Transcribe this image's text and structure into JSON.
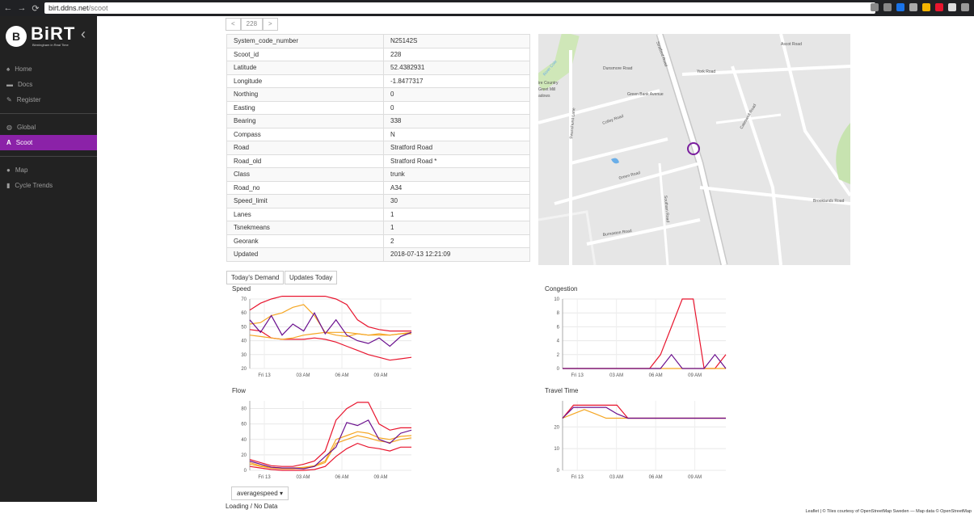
{
  "browser": {
    "url_host": "birt.ddns.net",
    "url_path": "/scoot"
  },
  "sidebar": {
    "brand": "BiRT",
    "tagline": "Birmingham in Real Time",
    "items": [
      {
        "label": "Home",
        "icon": "home-icon"
      },
      {
        "label": "Docs",
        "icon": "folder-icon"
      },
      {
        "label": "Register",
        "icon": "pencil-icon"
      },
      {
        "label": "Global",
        "icon": "globe-icon"
      },
      {
        "label": "Scoot",
        "icon": "scoot-icon"
      },
      {
        "label": "Map",
        "icon": "map-marker-icon"
      },
      {
        "label": "Cycle Trends",
        "icon": "bar-chart-icon"
      }
    ],
    "active": "Scoot"
  },
  "pager": {
    "prev": "<",
    "value": "228",
    "next": ">"
  },
  "properties": [
    [
      "System_code_number",
      "N25142S"
    ],
    [
      "Scoot_id",
      "228"
    ],
    [
      "Latitude",
      "52.4382931"
    ],
    [
      "Longitude",
      "-1.8477317"
    ],
    [
      "Northing",
      "0"
    ],
    [
      "Easting",
      "0"
    ],
    [
      "Bearing",
      "338"
    ],
    [
      "Compass",
      "N"
    ],
    [
      "Road",
      "Stratford Road"
    ],
    [
      "Road_old",
      "Stratford Road *"
    ],
    [
      "Class",
      "trunk"
    ],
    [
      "Road_no",
      "A34"
    ],
    [
      "Speed_limit",
      "30"
    ],
    [
      "Lanes",
      "1"
    ],
    [
      "Tsnekmeans",
      "1"
    ],
    [
      "Georank",
      "2"
    ],
    [
      "Updated",
      "2018-07-13 12:21:09"
    ]
  ],
  "map_labels": [
    "Stratford Road",
    "York Road",
    "Green Bank Avenue",
    "Cateswell Road",
    "Colley Road",
    "Green Road",
    "Burnaston Road",
    "Brooklands Road",
    "Swanshurst Lane",
    "Southam Road",
    "Ascot Road",
    "Dunsmore Road",
    "River Cole",
    "ire Country",
    "Greet Mill",
    "adows"
  ],
  "tabs": {
    "demand": "Today's Demand",
    "updates": "Updates Today"
  },
  "dropdown": {
    "label": "averagespeed"
  },
  "status": "Loading / No Data",
  "attribution": "Leaflet | © Tiles courtesy of OpenStreetMap Sweden — Map data © OpenStreetMap",
  "colors": {
    "active": "#8b22a8",
    "series_purple": "#6a0f8e",
    "series_red": "#e8152e",
    "series_orange": "#f5a623"
  },
  "chart_data": [
    {
      "type": "line",
      "title": "Speed",
      "x_ticks": [
        "Fri 13",
        "03 AM",
        "06 AM",
        "09 AM"
      ],
      "ylim": [
        20,
        70
      ],
      "y_ticks": [
        20,
        30,
        40,
        50,
        60,
        70
      ],
      "series": [
        {
          "color": "#e8152e",
          "values": [
            62,
            67,
            70,
            72,
            72,
            72,
            72,
            72,
            70,
            66,
            55,
            50,
            48,
            47,
            47,
            47
          ]
        },
        {
          "color": "#e8152e",
          "values": [
            48,
            47,
            42,
            41,
            41,
            41,
            42,
            41,
            39,
            36,
            33,
            30,
            28,
            26,
            27,
            28
          ]
        },
        {
          "color": "#f5a623",
          "values": [
            52,
            53,
            58,
            60,
            64,
            66,
            58,
            46,
            44,
            43,
            45,
            44,
            45,
            44,
            45,
            46
          ]
        },
        {
          "color": "#f5a623",
          "values": [
            44,
            43,
            42,
            41,
            42,
            44,
            45,
            46,
            46,
            46,
            45,
            44,
            44,
            44,
            45,
            45
          ]
        },
        {
          "color": "#6a0f8e",
          "values": [
            55,
            46,
            58,
            44,
            52,
            47,
            60,
            45,
            55,
            44,
            40,
            38,
            42,
            36,
            43,
            46
          ]
        }
      ]
    },
    {
      "type": "line",
      "title": "Congestion",
      "x_ticks": [
        "Fri 13",
        "03 AM",
        "06 AM",
        "09 AM"
      ],
      "ylim": [
        0,
        10
      ],
      "y_ticks": [
        0,
        2,
        4,
        6,
        8,
        10
      ],
      "series": [
        {
          "color": "#e8152e",
          "values": [
            0,
            0,
            0,
            0,
            0,
            0,
            0,
            0,
            0,
            2,
            6,
            10,
            10,
            0,
            0,
            2
          ]
        },
        {
          "color": "#f5a623",
          "values": [
            0,
            0,
            0,
            0,
            0,
            0,
            0,
            0,
            0,
            0,
            0,
            0,
            0,
            0,
            0,
            0
          ]
        },
        {
          "color": "#6a0f8e",
          "values": [
            0,
            0,
            0,
            0,
            0,
            0,
            0,
            0,
            0,
            0,
            2,
            0,
            0,
            0,
            2,
            0
          ]
        }
      ]
    },
    {
      "type": "line",
      "title": "Flow",
      "x_ticks": [
        "Fri 13",
        "03 AM",
        "06 AM",
        "09 AM"
      ],
      "ylim": [
        0,
        90
      ],
      "y_ticks": [
        0,
        20,
        40,
        60,
        80
      ],
      "series": [
        {
          "color": "#e8152e",
          "values": [
            14,
            10,
            6,
            5,
            5,
            8,
            12,
            25,
            65,
            80,
            88,
            88,
            60,
            52,
            55,
            55
          ]
        },
        {
          "color": "#e8152e",
          "values": [
            5,
            3,
            1,
            0,
            0,
            0,
            1,
            5,
            18,
            28,
            35,
            30,
            28,
            25,
            30,
            30
          ]
        },
        {
          "color": "#f5a623",
          "values": [
            10,
            6,
            4,
            3,
            3,
            4,
            6,
            12,
            40,
            45,
            50,
            48,
            42,
            40,
            44,
            45
          ]
        },
        {
          "color": "#f5a623",
          "values": [
            8,
            5,
            3,
            2,
            2,
            3,
            5,
            10,
            35,
            40,
            45,
            42,
            38,
            36,
            40,
            42
          ]
        },
        {
          "color": "#6a0f8e",
          "values": [
            12,
            8,
            4,
            3,
            3,
            2,
            5,
            18,
            30,
            62,
            58,
            65,
            40,
            35,
            48,
            52
          ]
        }
      ]
    },
    {
      "type": "line",
      "title": "Travel Time",
      "x_ticks": [
        "Fri 13",
        "03 AM",
        "06 AM",
        "09 AM"
      ],
      "ylim": [
        0,
        32
      ],
      "y_ticks": [
        0,
        10,
        20
      ],
      "series": [
        {
          "color": "#e8152e",
          "values": [
            24,
            30,
            30,
            30,
            30,
            30,
            24,
            24,
            24,
            24,
            24,
            24,
            24,
            24,
            24,
            24
          ]
        },
        {
          "color": "#f5a623",
          "values": [
            24,
            26,
            28,
            26,
            24,
            24,
            24,
            24,
            24,
            24,
            24,
            24,
            24,
            24,
            24,
            24
          ]
        },
        {
          "color": "#6a0f8e",
          "values": [
            24,
            29,
            29,
            29,
            29,
            26,
            24,
            24,
            24,
            24,
            24,
            24,
            24,
            24,
            24,
            24
          ]
        }
      ]
    }
  ]
}
